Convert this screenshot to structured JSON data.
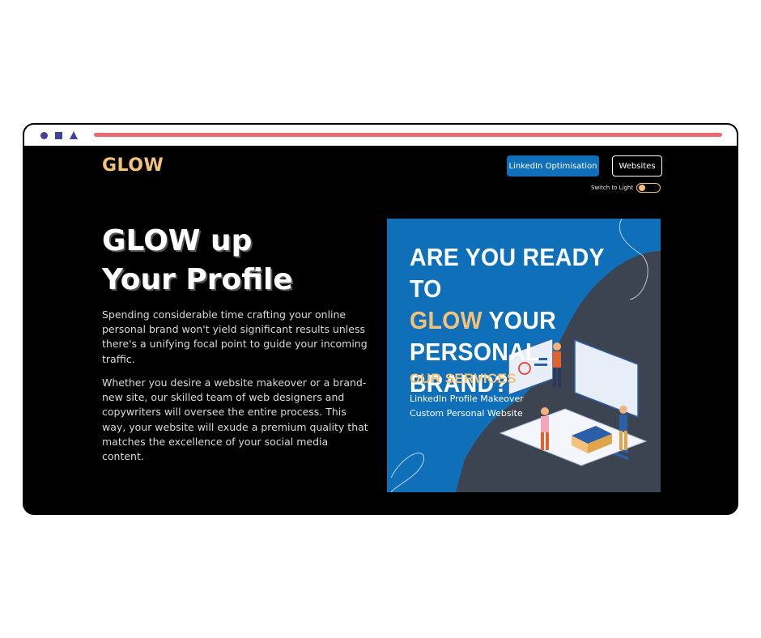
{
  "site": {
    "logo": "GLOW",
    "nav": {
      "primary_button": "LinkedIn Optimisation",
      "secondary_button": "Websites"
    },
    "theme_toggle": {
      "label": "Switch to Light",
      "state": "dark"
    }
  },
  "hero": {
    "headline_line1": "GLOW up",
    "headline_line2": "Your Profile",
    "paragraph1": "Spending considerable time crafting your online personal brand won't yield significant results unless there's a unifying focal point to guide your incoming traffic.",
    "paragraph2": "Whether you desire a website makeover or a brand-new site, our skilled team of web designers and copywriters will oversee the entire process. This way, your website will exude a premium quality that matches the excellence of your social media content."
  },
  "promo": {
    "title_part1": "ARE YOU READY TO",
    "title_highlight": "GLOW",
    "title_part2": "YOUR",
    "title_part3": "PERSONAL BRAND?",
    "services_title": "OUR SERVICES",
    "services": [
      "LinkedIn Profile Makeover",
      "Custom Personal Website"
    ]
  },
  "colors": {
    "accent": "#f2c17a",
    "brand_blue": "#0f6fb8",
    "background": "#000000",
    "bar": "#ec6a6f",
    "chrome_icons": "#3f4594"
  },
  "icons": [
    "circle-icon",
    "square-icon",
    "triangle-icon"
  ]
}
